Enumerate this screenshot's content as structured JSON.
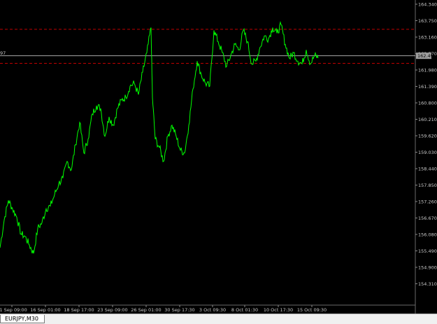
{
  "chart_data": {
    "type": "line",
    "symbol_timeframe": "EURJPY,M30",
    "colors": {
      "background": "#000000",
      "line": "#00ff00",
      "hline": "#c0c0c0",
      "level": "#c00000",
      "price_box": "#a0a0a0"
    },
    "ylim": [
      153.9,
      164.5
    ],
    "y_ticks": [
      "164.340",
      "163.750",
      "163.160",
      "162.570",
      "161.980",
      "161.390",
      "160.800",
      "160.210",
      "159.620",
      "159.030",
      "158.440",
      "157.850",
      "157.260",
      "156.670",
      "156.080",
      "155.490",
      "154.900",
      "154.310"
    ],
    "x_ticks": [
      "11 Sep 09:00",
      "16 Sep 01:00",
      "18 Sep 17:00",
      "23 Sep 09:00",
      "26 Sep 01:00",
      "30 Sep 17:30",
      "3 Oct 09:30",
      "8 Oct 01:30",
      "10 Oct 17:30",
      "15 Oct 09:30"
    ],
    "current_price_label": "162.49",
    "left_hline_label": "97",
    "levels": [
      163.44,
      162.22
    ],
    "current_price": 162.49,
    "x": [
      0,
      6,
      12,
      18,
      24,
      30,
      36,
      42,
      48,
      54,
      60,
      66,
      72,
      78,
      84,
      90,
      96,
      102,
      108,
      114,
      120,
      126,
      132,
      138,
      144,
      150,
      156,
      162,
      168,
      174,
      180,
      186,
      192,
      198,
      204,
      210,
      216,
      218,
      222,
      228,
      234,
      240,
      246,
      252,
      258,
      264,
      270,
      276,
      282,
      288,
      294,
      300,
      306,
      312,
      318,
      324,
      330,
      336,
      342,
      348,
      354,
      360,
      366,
      372,
      378,
      384,
      390,
      396,
      402,
      408,
      414,
      420,
      426,
      432,
      438,
      444,
      450,
      456,
      462,
      468
    ],
    "values": [
      155.6,
      156.6,
      157.3,
      157.0,
      156.7,
      156.1,
      156.0,
      155.7,
      155.4,
      156.3,
      156.5,
      157.0,
      157.1,
      157.5,
      157.9,
      158.1,
      158.7,
      158.4,
      159.3,
      160.1,
      159.0,
      159.5,
      160.4,
      160.7,
      160.6,
      159.6,
      160.3,
      160.0,
      160.6,
      160.9,
      161.0,
      161.4,
      161.5,
      161.1,
      161.9,
      162.6,
      163.5,
      161.0,
      159.5,
      159.2,
      158.7,
      159.6,
      160.0,
      159.6,
      159.1,
      159.0,
      160.0,
      161.3,
      162.3,
      161.8,
      161.5,
      161.4,
      163.4,
      163.0,
      162.6,
      162.1,
      162.5,
      162.9,
      162.7,
      163.4,
      163.0,
      162.2,
      162.3,
      162.8,
      163.2,
      163.1,
      163.5,
      163.3,
      163.6,
      162.9,
      162.4,
      162.6,
      162.3,
      162.2,
      162.7,
      162.2,
      162.5,
      162.4
    ]
  },
  "tabs": {
    "active_label": "EURJPY,M30"
  }
}
